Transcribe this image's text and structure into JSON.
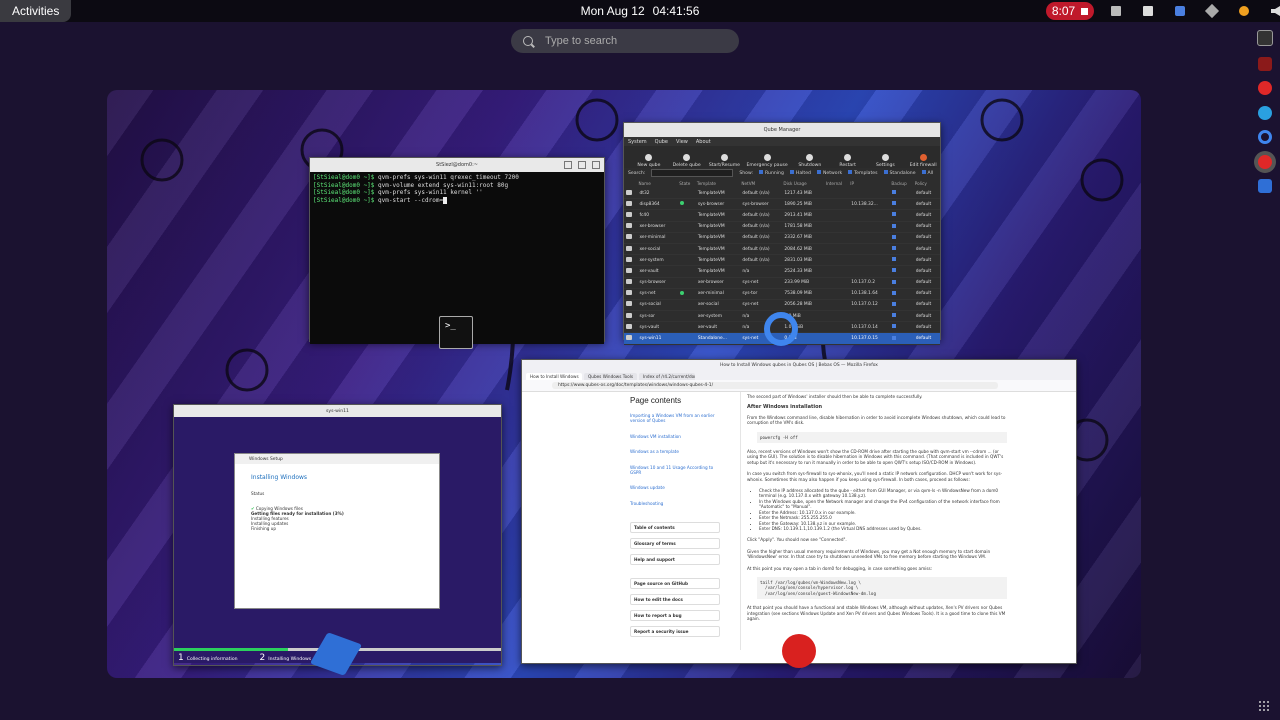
{
  "topbar": {
    "activities_label": "Activities",
    "date": "Mon Aug 12",
    "time": "04:41:56",
    "recording_time": "8:07",
    "colors": {
      "recording": "#c0192b",
      "bar": "#0c0a12"
    },
    "tray_icons": [
      "window-icon",
      "windows-icon",
      "qubes-shield-icon",
      "network-icon",
      "sun-icon",
      "volume-icon",
      "battery-icon",
      "power-icon"
    ]
  },
  "search": {
    "placeholder": "Type to search"
  },
  "terminal": {
    "title": "StSiezl@dom0:~",
    "lines": [
      {
        "prompt": "[StSieal@dom0 ~]$ ",
        "cmd": "qvm-prefs sys-win11 qrexec_timeout 7200"
      },
      {
        "prompt": "[StSieal@dom0 ~]$ ",
        "cmd": "qvm-volume extend sys-win11:root 80g"
      },
      {
        "prompt": "[StSieal@dom0 ~]$ ",
        "cmd": "qvm-prefs sys-win11 kernel ''"
      },
      {
        "prompt": "[StSieal@dom0 ~]$ ",
        "cmd": "qvm-start --cdrom="
      }
    ]
  },
  "qube_manager": {
    "title": "Qube Manager",
    "menu": [
      "System",
      "Qube",
      "View",
      "About"
    ],
    "toolbar": [
      "New qube",
      "Delete qube",
      "Start/Resume",
      "Emergency pause",
      "Shutdown",
      "Restart",
      "Settings",
      "Edit firewall"
    ],
    "search_label": "Search:",
    "show_label": "Show:",
    "filters": [
      "Running",
      "Halted",
      "Network",
      "Templates",
      "Standalone",
      "All"
    ],
    "columns": [
      "",
      "Name",
      "State",
      "Template",
      "NetVM",
      "Disk Usage",
      "Internal",
      "IP",
      "Backup",
      "Last backup",
      "Policy"
    ],
    "rows": [
      {
        "name": "dt32",
        "template": "TemplateVM",
        "netvm": "default (n/a)",
        "disk": "1217.43 MiB",
        "ip": "",
        "policy": "default",
        "state": ""
      },
      {
        "name": "disp8364",
        "template": "sys-browser",
        "netvm": "sys-browser",
        "disk": "1890.25 MiB",
        "ip": "10.138.32...",
        "policy": "default",
        "state": "green"
      },
      {
        "name": "fc40",
        "template": "TemplateVM",
        "netvm": "default (n/a)",
        "disk": "2913.41 MiB",
        "ip": "",
        "policy": "default",
        "state": ""
      },
      {
        "name": "xer-browser",
        "template": "TemplateVM",
        "netvm": "default (n/a)",
        "disk": "1781.58 MiB",
        "ip": "",
        "policy": "default",
        "state": ""
      },
      {
        "name": "xer-minimal",
        "template": "TemplateVM",
        "netvm": "default (n/a)",
        "disk": "2332.67 MiB",
        "ip": "",
        "policy": "default",
        "state": ""
      },
      {
        "name": "xer-social",
        "template": "TemplateVM",
        "netvm": "default (n/a)",
        "disk": "2084.62 MiB",
        "ip": "",
        "policy": "default",
        "state": ""
      },
      {
        "name": "xer-system",
        "template": "TemplateVM",
        "netvm": "default (n/a)",
        "disk": "2831.03 MiB",
        "ip": "",
        "policy": "default",
        "state": ""
      },
      {
        "name": "xer-vault",
        "template": "TemplateVM",
        "netvm": "n/a",
        "disk": "2524.33 MiB",
        "ip": "",
        "policy": "default",
        "state": ""
      },
      {
        "name": "sys-browser",
        "template": "xer-browser",
        "netvm": "sys-net",
        "disk": "233.99 MiB",
        "ip": "10.137.0.2",
        "policy": "default",
        "state": ""
      },
      {
        "name": "sys-net",
        "template": "xer-minimal",
        "netvm": "sys-tor",
        "disk": "7538.09 MiB",
        "ip": "10.138.1.64",
        "policy": "default",
        "state": "green"
      },
      {
        "name": "sys-social",
        "template": "xer-social",
        "netvm": "sys-net",
        "disk": "2056.28 MiB",
        "ip": "10.137.0.12",
        "policy": "default",
        "state": ""
      },
      {
        "name": "sys-sor",
        "template": "xer-system",
        "netvm": "n/a",
        "disk": "0.0 MiB",
        "ip": "",
        "policy": "default",
        "state": ""
      },
      {
        "name": "sys-vault",
        "template": "xer-vault",
        "netvm": "n/a",
        "disk": "1.01 GiB",
        "ip": "10.137.0.14",
        "policy": "default",
        "state": ""
      },
      {
        "name": "sys-win11",
        "template": "Standalone...",
        "netvm": "sys-net",
        "disk": "0 MiB",
        "ip": "10.137.0.15",
        "policy": "default",
        "state": "selected"
      }
    ]
  },
  "firefox": {
    "title": "How to Install Windows qubes in Qubes OS | Bebas OS — Mozilla Firefox",
    "tabs": [
      "How to Install Windows",
      "Qubes Windows Tools",
      "Index of /r4.2/current/dom0/fc"
    ],
    "url": "https://www.qubes-os.org/doc/templates/windows/windows-qubes-4-1/",
    "toc_title": "Page contents",
    "toc_links": [
      "Importing a Windows VM from an earlier version of Qubes",
      "Windows VM installation",
      "Windows as a template",
      "Windows 10 and 11 Usage According to GSPR",
      "Windows update",
      "Troubleshooting"
    ],
    "toc_buttons": [
      "Table of contents",
      "Glossary of terms",
      "Help and support",
      "Page source on GitHub",
      "How to edit the docs",
      "How to report a bug",
      "Report a security issue"
    ],
    "article": {
      "intro": "The second part of Windows' installer should then be able to complete successfully.",
      "heading": "After Windows installation",
      "para1": "From the Windows command line, disable hibernation in order to avoid incomplete Windows shutdown, which could lead to corruption of the VM's disk.",
      "code1": "powercfg -H off",
      "para2": "Also, recent versions of Windows won't show the CD-ROM drive after starting the qube with qvm-start vm --cdrom ... (or using the GUI). The solution is to disable hibernation in Windows with this command. (That command is included in QWT's setup but it's necessary to run it manually in order to be able to open QWT's setup ISO/CD-ROM in Windows).",
      "para3": "In case you switch from sys-firewall to sys-whonix, you'll need a static IP network configuration. DHCP won't work for sys-whonix. Sometimes this may also happen if you keep using sys-firewall. In both cases, proceed as follows:",
      "bullets": [
        "Check the IP address allocated to the qube - either from GUI Manager, or via qvm-ls -n WindowsNew from a dom0 terminal (e.g. 10.137.0.x with gateway 10.138.y.z).",
        "In the Windows qube, open the Network manager and change the IPv4 configuration of the network interface from \"Automatic\" to \"Manual\".",
        "Enter the Address: 10.137.0.x in our example.",
        "Enter the Netmask: 255.255.255.0",
        "Enter the Gateway: 10.138.y.z in our example.",
        "Enter DNS: 10.139.1.1,10.139.1.2 (the Virtual DNS addresses used by Qubes."
      ],
      "para4": "Click \"Apply\". You should now see \"Connected\".",
      "para5": "Given the higher than usual memory requirements of Windows, you may get a Not enough memory to start domain 'WindowsNew' error. In that case try to shutdown unneeded VMs to free memory before starting the Windows VM.",
      "para6": "At this point you may open a tab in dom0 for debugging, in case something goes amiss:",
      "code2": "tailf /var/log/qubes/vm-WindowsNew.log \\\n  /var/log/xen/console/hypervisor.log \\\n  /var/log/xen/console/guest-WindowsNew-dm.log",
      "para7": "At that point you should have a functional and stable Windows VM, although without updates, Xen's PV drivers nor Qubes integration (see sections Windows Update and Xen PV drivers and Qubes Windows Tools). It is a good time to clone this VM again."
    }
  },
  "win11": {
    "title": "sys-win11",
    "dialog_header": "Windows Setup",
    "dialog_title": "Installing Windows",
    "status_label": "Status",
    "status_items": [
      "Copying Windows files",
      "Getting files ready for installation (3%)",
      "Installing features",
      "Installing updates",
      "Finishing up"
    ],
    "steps": [
      {
        "n": "1",
        "label": "Collecting information"
      },
      {
        "n": "2",
        "label": "Installing Windows"
      }
    ],
    "progress_percent": 35
  }
}
